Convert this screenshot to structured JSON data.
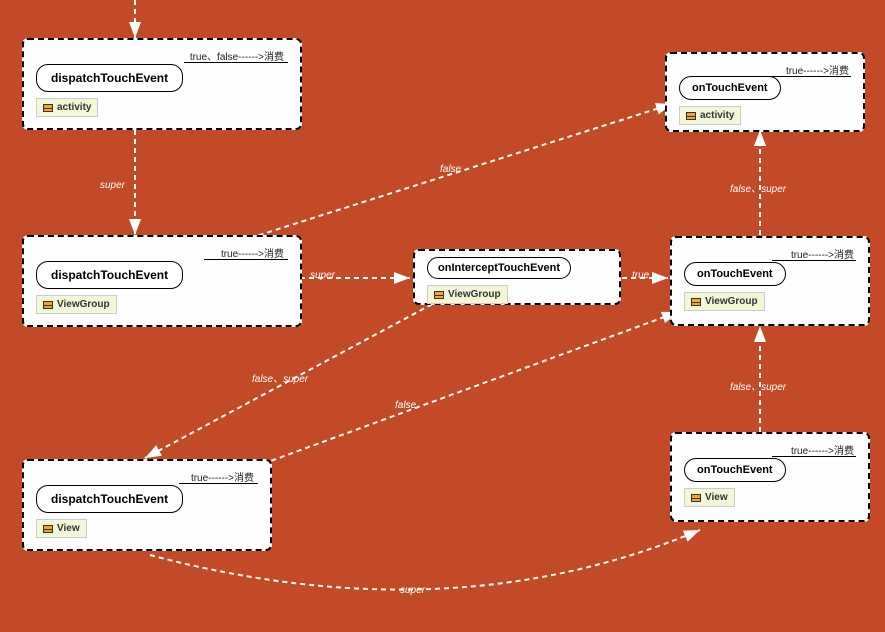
{
  "nodes": {
    "n1": {
      "title": "dispatchTouchEvent",
      "tag": "activity",
      "annot": "true、false------>消费"
    },
    "n2": {
      "title": "dispatchTouchEvent",
      "tag": "ViewGroup",
      "annot": "true------>消费"
    },
    "n3": {
      "title": "dispatchTouchEvent",
      "tag": "View",
      "annot": "true------>消费"
    },
    "n4": {
      "title": "onInterceptTouchEvent",
      "tag": "ViewGroup",
      "annot": ""
    },
    "n5": {
      "title": "onTouchEvent",
      "tag": "activity",
      "annot": "true------>消费"
    },
    "n6": {
      "title": "onTouchEvent",
      "tag": "ViewGroup",
      "annot": "true------>消费"
    },
    "n7": {
      "title": "onTouchEvent",
      "tag": "View",
      "annot": "true------>消费"
    }
  },
  "edges": {
    "e1": "super",
    "e2": "super",
    "e3": "false、super",
    "e4": "true",
    "e5": "false",
    "e6": "false",
    "e7": "false、super",
    "e8": "false、super",
    "e9": "super"
  }
}
